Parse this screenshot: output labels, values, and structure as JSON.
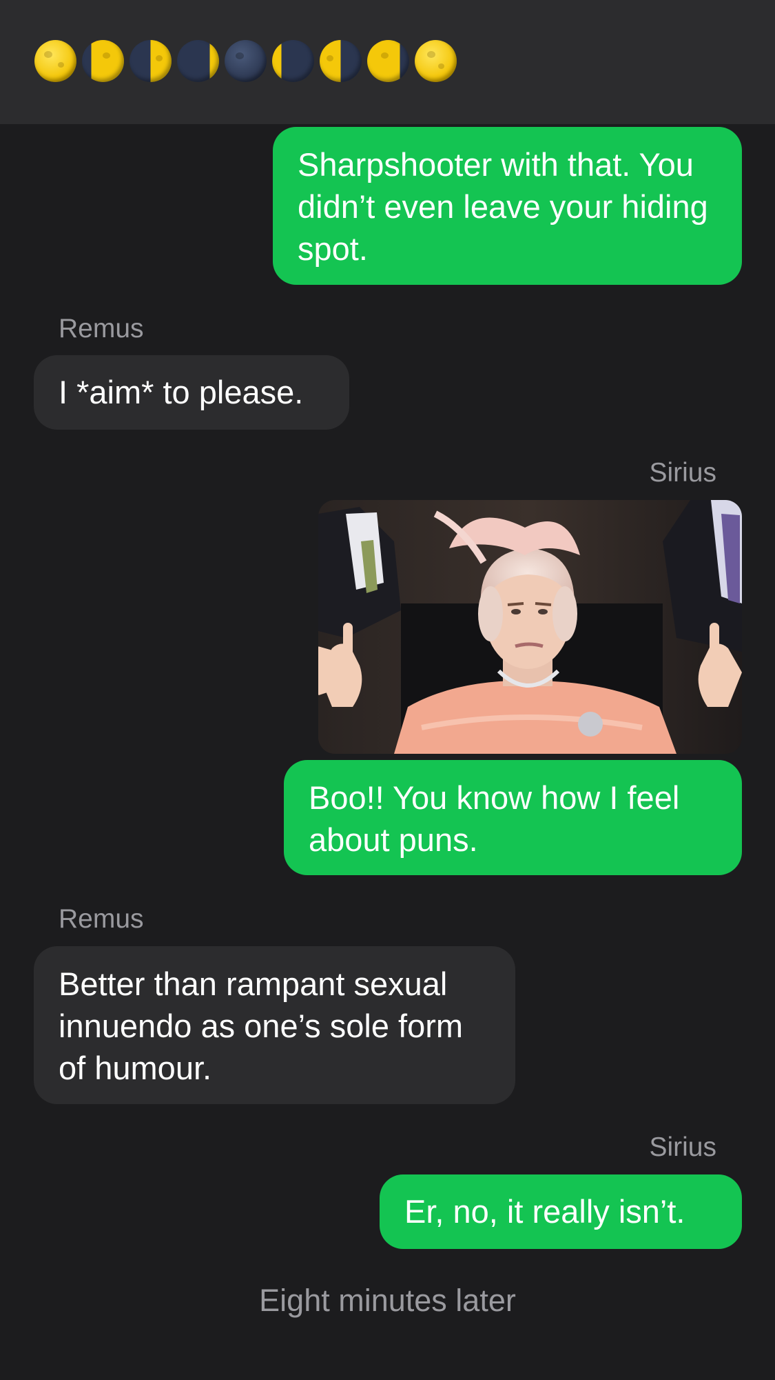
{
  "header": {
    "moon_icons": [
      "full-moon",
      "waning-gibbous-moon",
      "last-quarter-moon",
      "waning-crescent-moon",
      "new-moon",
      "waxing-crescent-moon",
      "first-quarter-moon",
      "waxing-gibbous-moon",
      "full-moon"
    ]
  },
  "messages": [
    {
      "type": "sent",
      "text": "Sharpshooter with that. You didn’t even leave your hiding spot."
    },
    {
      "type": "sender",
      "name": "Remus"
    },
    {
      "type": "recv",
      "text": "I *aim* to please."
    },
    {
      "type": "sender",
      "name": "Sirius"
    },
    {
      "type": "gif",
      "description": "queen-middle-fingers-gif"
    },
    {
      "type": "sent",
      "text": "Boo!! You know how I feel about puns."
    },
    {
      "type": "sender",
      "name": "Remus"
    },
    {
      "type": "recv",
      "text": "Better than rampant sexual innuendo as one’s sole form of humour."
    },
    {
      "type": "sender",
      "name": "Sirius"
    },
    {
      "type": "sent",
      "text": "Er, no, it really isn’t."
    }
  ],
  "footer_note": "Eight minutes later",
  "colors": {
    "background": "#1c1c1e",
    "header": "#2c2c2e",
    "sent_bubble": "#14c452",
    "received_bubble": "#2c2c2e",
    "meta_text": "#9a9a9f"
  }
}
